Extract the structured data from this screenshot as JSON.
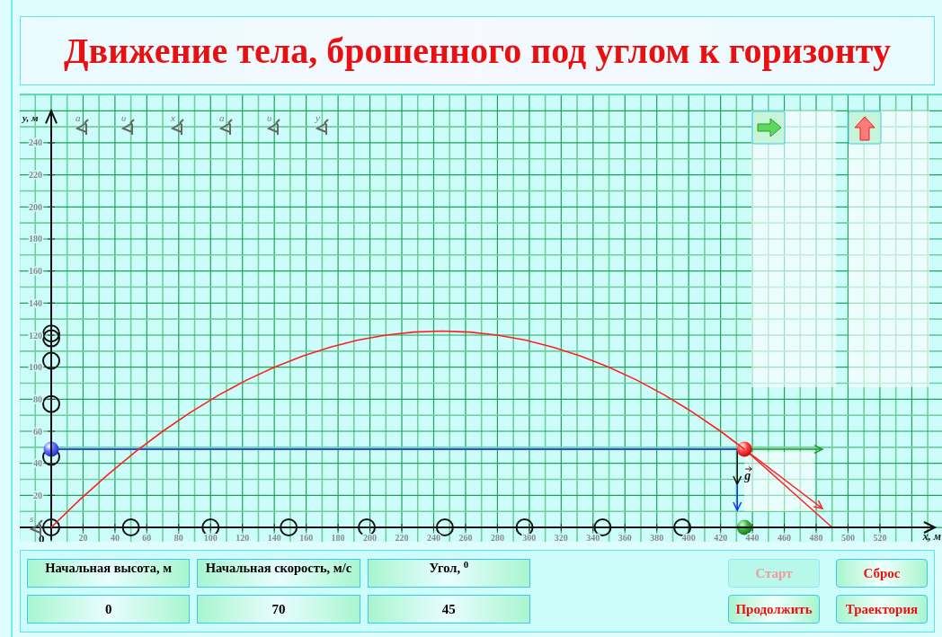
{
  "title": "Движение тела, брошенного под углом к горизонту",
  "plot": {
    "graph_buttons": [
      {
        "label": "a"
      },
      {
        "label": "υ"
      },
      {
        "label": "x"
      },
      {
        "label": "a"
      },
      {
        "label": "υ"
      },
      {
        "label": "y"
      }
    ],
    "origin_button": {
      "label": "s"
    },
    "origin_label": "0",
    "g_label": "g",
    "direction_buttons": [
      {
        "kind": "right"
      },
      {
        "kind": "up"
      }
    ],
    "chart_data": {
      "type": "line",
      "xlabel": "x, м",
      "ylabel": "y, м",
      "x": [
        0,
        17.5,
        35,
        52.5,
        70,
        87.5,
        105,
        122.5,
        140,
        157.5,
        175,
        192.5,
        210,
        227.5,
        245,
        262.5,
        280,
        297.5,
        315,
        332.5,
        350,
        367.5,
        385,
        402.5,
        420,
        435
      ],
      "series": [
        {
          "color": "#ff2020",
          "values": [
            0,
            16.9,
            32.5,
            46.9,
            60,
            71.9,
            82.5,
            91.9,
            100,
            106.9,
            112.5,
            116.9,
            120,
            121.9,
            122.5,
            121.9,
            120,
            116.9,
            112.5,
            106.9,
            100,
            91.9,
            82.5,
            71.9,
            60,
            48.8
          ]
        }
      ],
      "xlim": [
        -20,
        555
      ],
      "ylim": [
        -8,
        260
      ],
      "xticks": [
        20,
        40,
        60,
        80,
        100,
        120,
        140,
        160,
        180,
        200,
        220,
        240,
        260,
        280,
        300,
        320,
        340,
        360,
        380,
        400,
        420,
        440,
        460,
        480,
        500,
        520
      ],
      "yticks": [
        20,
        40,
        60,
        80,
        100,
        120,
        140,
        160,
        180,
        200,
        220,
        240
      ]
    }
  },
  "inputs": [
    {
      "label": "Начальная высота, м",
      "value": "0"
    },
    {
      "label": "Начальная скорость, м/с",
      "value": "70"
    },
    {
      "label": "Угол, $^{0}$",
      "value": "45"
    }
  ],
  "buttons": [
    {
      "label": "Старт",
      "disabled": true
    },
    {
      "label": "Сброс",
      "disabled": false
    },
    {
      "label": "Продолжить",
      "disabled": false
    },
    {
      "label": "Траектория",
      "disabled": false
    }
  ]
}
